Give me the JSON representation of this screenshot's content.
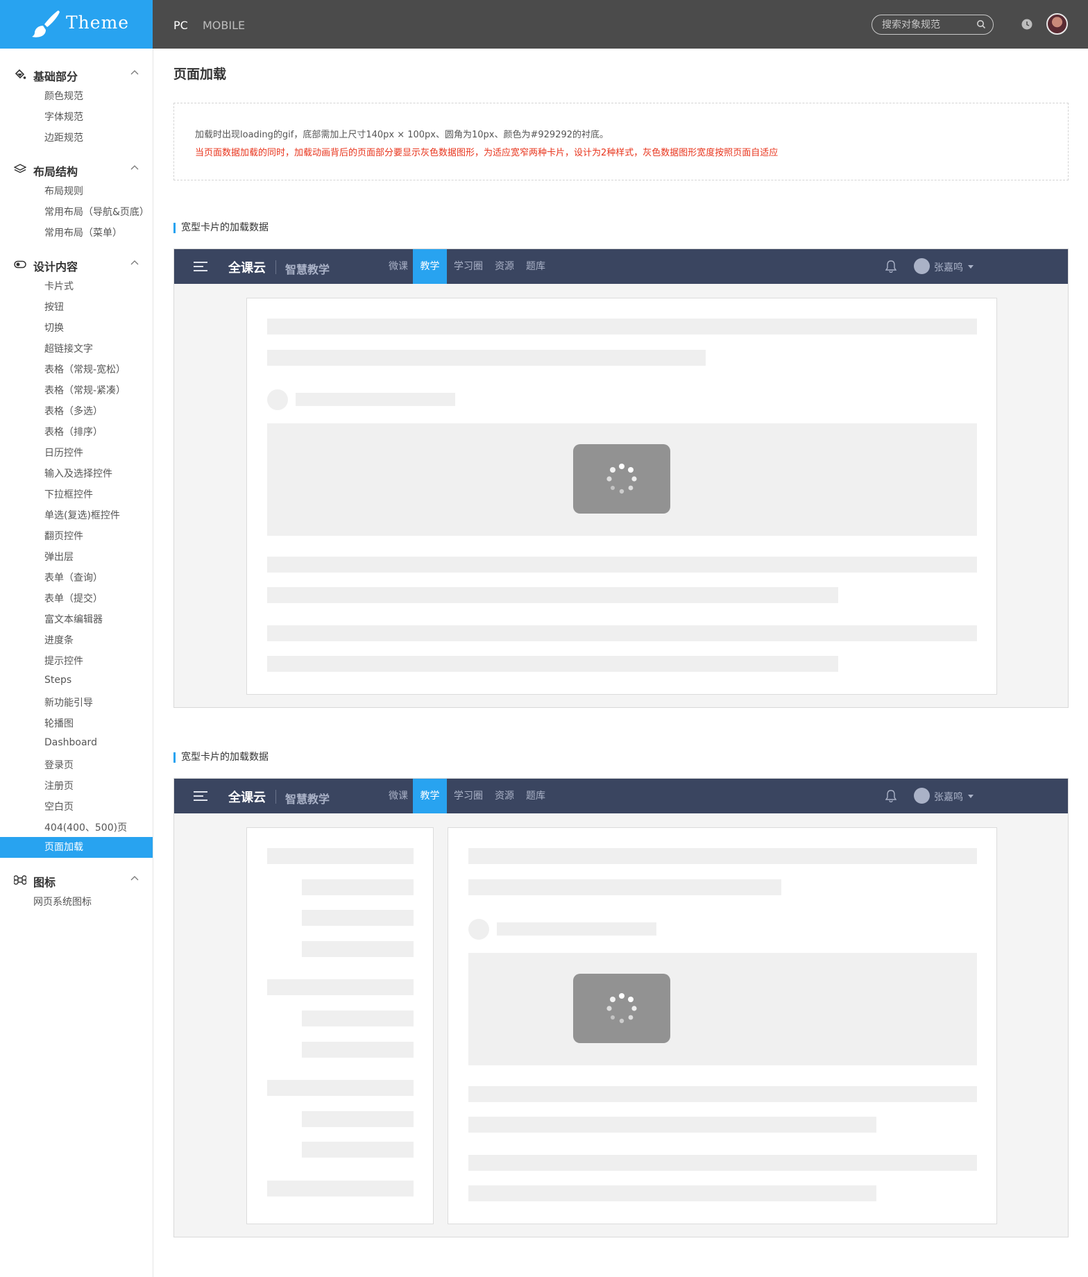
{
  "brand": {
    "name": "Theme",
    "accent": "#28a3f0"
  },
  "top": {
    "platforms": [
      "PC",
      "MOBILE"
    ],
    "search_placeholder": "搜索对象规范"
  },
  "sidebar": {
    "groups": [
      {
        "title": "基础部分",
        "icon": "paint-bucket-icon",
        "items": [
          "颜色规范",
          "字体规范",
          "边距规范"
        ]
      },
      {
        "title": "布局结构",
        "icon": "layers-icon",
        "items": [
          "布局规则",
          "常用布局（导航&页底）",
          "常用布局（菜单）"
        ]
      },
      {
        "title": "设计内容",
        "icon": "toggle-icon",
        "items": [
          "卡片式",
          "按钮",
          "切换",
          "超链接文字",
          "表格（常规-宽松）",
          "表格（常规-紧凑）",
          "表格（多选）",
          "表格（排序）",
          "日历控件",
          "输入及选择控件",
          "下拉框控件",
          "单选(复选)框控件",
          "翻页控件",
          "弹出层",
          "表单（查询）",
          "表单（提交）",
          "富文本编辑器",
          "进度条",
          "提示控件",
          "Steps",
          "新功能引导",
          "轮播图",
          "Dashboard",
          "登录页",
          "注册页",
          "空白页",
          "404(400、500)页",
          "页面加载"
        ]
      },
      {
        "title": "图标",
        "icon": "command-icon",
        "items": [
          "网页系统图标"
        ]
      }
    ],
    "active_item": "页面加载"
  },
  "main": {
    "title": "页面加载",
    "note_line1": "加载时出现loading的gif，底部需加上尺寸140px × 100px、圆角为10px、颜色为#929292的衬底。",
    "note_line2": "当页面数据加载的同时，加载动画背后的页面部分要显示灰色数据图形，为适应宽窄两种卡片，设计为2种样式，灰色数据图形宽度按照页面自适应",
    "note_highlight_color": "#e8341c",
    "section1_label": "宽型卡片的加载数据",
    "section2_label": "宽型卡片的加载数据"
  },
  "app_nav": {
    "brand": "全课云",
    "product": "智慧教学",
    "tabs": [
      "微课",
      "教学",
      "学习圈",
      "资源",
      "题库"
    ],
    "active_tab": "教学",
    "user": "张嘉鸣",
    "bg_color": "#3a4560"
  },
  "loader": {
    "bg_color": "#929292"
  }
}
